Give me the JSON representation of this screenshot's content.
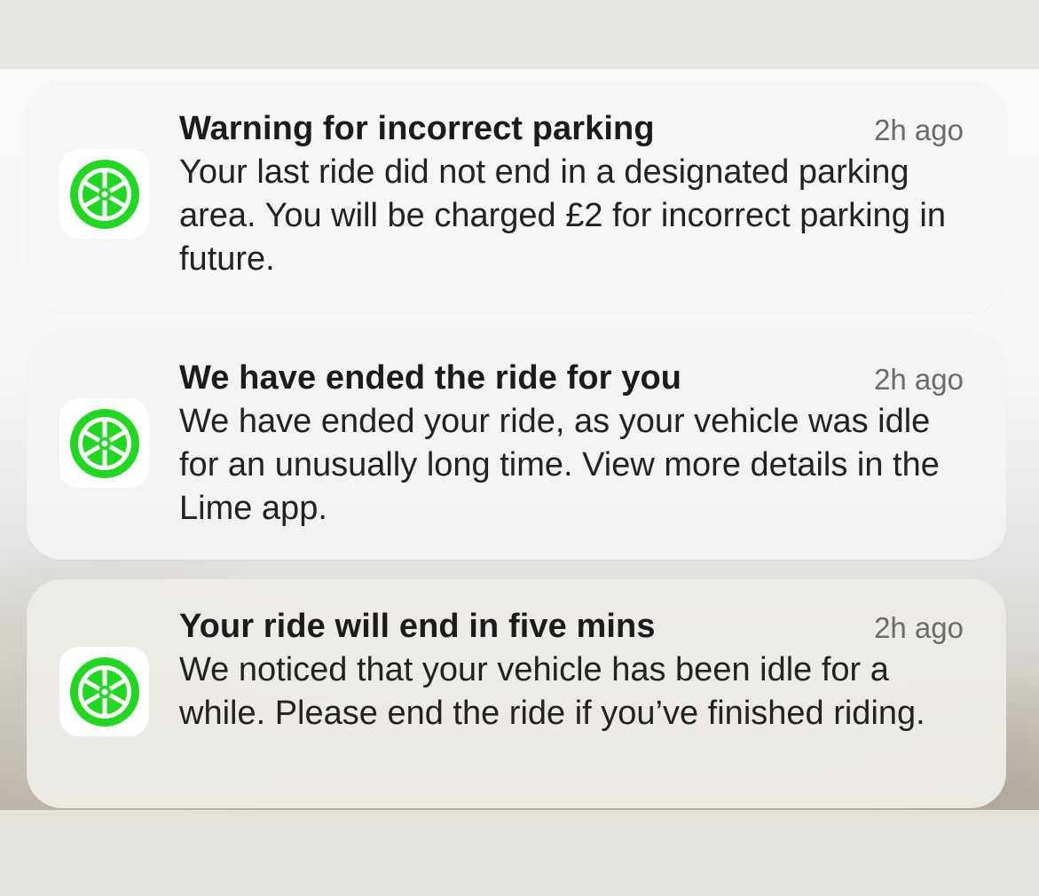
{
  "notifications": [
    {
      "app_icon": "lime-wheel-icon",
      "title": "Warning for incorrect parking",
      "time": "2h ago",
      "body": "Your last ride did not end in a designated parking area. You will be charged £2 for incorrect parking in future."
    },
    {
      "app_icon": "lime-wheel-icon",
      "title": "We have ended the ride for you",
      "time": "2h ago",
      "body": "We have ended your ride, as your vehicle was idle for an unusually long time. View more details in the Lime app."
    },
    {
      "app_icon": "lime-wheel-icon",
      "title": "Your ride will end in five mins",
      "time": "2h ago",
      "body": "We noticed that your vehicle has been idle for a while. Please end the ride if you’ve finished riding."
    }
  ],
  "colors": {
    "lime_green": "#1fd81f",
    "icon_background": "#ffffff"
  }
}
